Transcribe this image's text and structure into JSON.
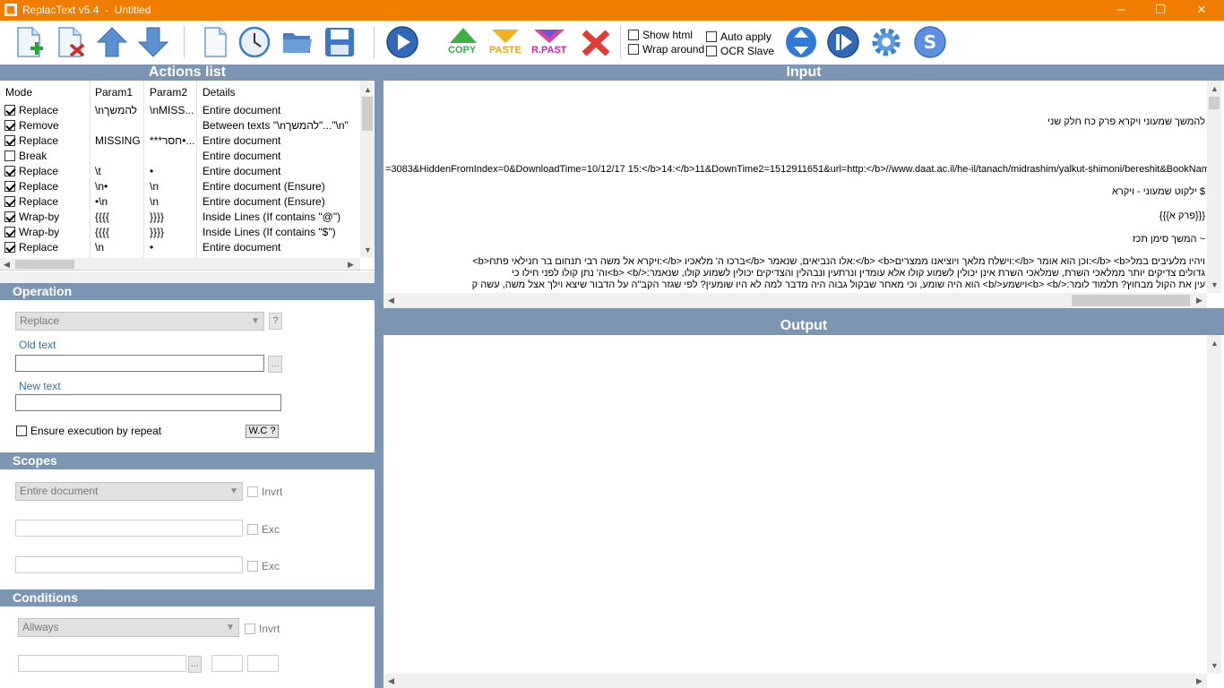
{
  "window": {
    "title": "ReplacText v5.4  -  Untitled",
    "minimize": "─",
    "restore": "❐",
    "close": "✕"
  },
  "toolbar": {
    "copy_label": "COPY",
    "paste_label": "PASTE",
    "rpast_label": "R.PAST",
    "show_html": "Show html",
    "wrap_around": "Wrap around",
    "auto_apply": "Auto apply",
    "ocr_slave": "OCR Slave"
  },
  "actions": {
    "title": "Actions list",
    "columns": [
      "Mode",
      "Param1",
      "Param2",
      "Details"
    ],
    "rows": [
      {
        "mode": "Replace",
        "p1": "\\nלהמשך",
        "p2": "\\nMISS...",
        "details": "Entire document",
        "checked": true
      },
      {
        "mode": "Remove",
        "p1": "",
        "p2": "",
        "details": "Between texts \"\\nלהמשך\"...\"\\n\"",
        "checked": true
      },
      {
        "mode": "Replace",
        "p1": "MISSING",
        "p2": "***חסר•...",
        "details": "Entire document",
        "checked": true
      },
      {
        "mode": "Break",
        "p1": "",
        "p2": "",
        "details": "Entire document",
        "checked": false
      },
      {
        "mode": "Replace",
        "p1": "\\t",
        "p2": "•",
        "details": "Entire document",
        "checked": true
      },
      {
        "mode": "Replace",
        "p1": "\\n•",
        "p2": "\\n",
        "details": "Entire document    (Ensure)",
        "checked": true
      },
      {
        "mode": "Replace",
        "p1": "•\\n",
        "p2": "\\n",
        "details": "Entire document    (Ensure)",
        "checked": true
      },
      {
        "mode": "Wrap-by",
        "p1": "{{{{",
        "p2": "}}}}",
        "details": "Inside Lines    (If contains \"@\")",
        "checked": true
      },
      {
        "mode": "Wrap-by",
        "p1": "{{{{",
        "p2": "}}}}",
        "details": "Inside Lines    (If contains \"$\")",
        "checked": true
      },
      {
        "mode": "Replace",
        "p1": "\\n",
        "p2": "•",
        "details": "Entire document",
        "checked": true
      }
    ]
  },
  "operation": {
    "title": "Operation",
    "mode_value": "Replace",
    "help": "?",
    "old_text_label": "Old text",
    "old_text_value": "",
    "browse": "...",
    "new_text_label": "New text",
    "new_text_value": "",
    "ensure_label": "Ensure execution by repeat",
    "wc_button": "W.C ?"
  },
  "scopes": {
    "title": "Scopes",
    "scope_value": "Entire document",
    "invrt": "Invrt",
    "exc1": "Exc",
    "exc2": "Exc"
  },
  "conditions": {
    "title": "Conditions",
    "cond_value": "Allways",
    "invrt": "Invrt",
    "browse": "..."
  },
  "input": {
    "title": "Input",
    "lines": [
      "להמשך שמעוני ויקרא פרק כח חלק שני",
      "=3083&HiddenFromIndex=0&DownloadTime=10/12/17 15:</b>14:</b>11&DownTime2=1512911651&url=http:</b>//www.daat.ac.il/he-il/tanach/midrashim/yalkut-shimoni/bereshit&BookName&",
      "$ ילקוט שמעוני - ויקרא",
      "{{{פרק א}}}",
      "~ המשך סימן תכז",
      "<b>ויקרא אל משה רבי תנחום בר חנילאי פתח:</b> ברכו ה' מלאכיו</b> אלו הנביאים, שנאמר:</b> <b>וישלח מלאך ויוציאנו ממצרים:</b> וכן הוא אומר:</b> <b>ויהיו מלעיבים במל",
      "גדולים צדיקים יותר ממלאכי השרת, שמלאכי השרת אינן יכולין לשמוע קולו אלא עומדין ונרתעין ונבהלין והצדיקים יכולין לשמוע קולו, שנאמר:</b> <b>וה' נתן קולו לפני חילו כי",
      "עין את הקול מבחוץ? תלמוד לומר:</b> <b>וישמע</b> הוא היה שומע, וכי מאחר שבקול גבוה היה מדבר למה לא היו שומעין? לפי שגזר הקב\"ה על הדבור שיצא וילך אצל משה, עשה ק"
    ]
  },
  "output": {
    "title": "Output"
  }
}
